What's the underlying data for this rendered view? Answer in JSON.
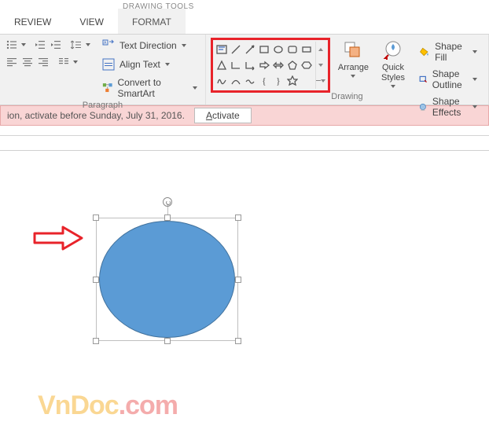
{
  "tabs": {
    "context_header": "DRAWING TOOLS",
    "review": "REVIEW",
    "view": "VIEW",
    "format": "FORMAT"
  },
  "paragraph": {
    "label": "Paragraph",
    "text_direction": "Text Direction",
    "align_text": "Align Text",
    "convert_smartart": "Convert to SmartArt"
  },
  "drawing": {
    "label": "Drawing",
    "arrange": "Arrange",
    "quick_styles": "Quick\nStyles",
    "shape_fill": "Shape Fill",
    "shape_outline": "Shape Outline",
    "shape_effects": "Shape Effects"
  },
  "activation": {
    "message": "ion, activate before Sunday, July 31, 2016.",
    "button": "Activate"
  },
  "watermark": {
    "part1": "VnDoc",
    "part2": ".com"
  },
  "shape": {
    "fill_color": "#5b9bd5",
    "outline_color": "#41719c",
    "type": "oval"
  }
}
